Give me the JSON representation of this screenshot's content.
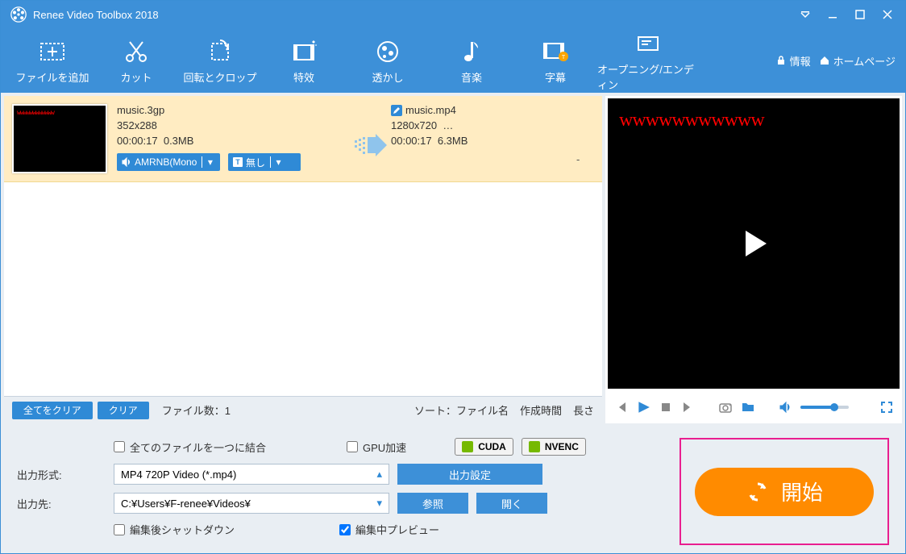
{
  "app": {
    "title": "Renee Video Toolbox 2018"
  },
  "toolbar": {
    "add_file": "ファイルを追加",
    "cut": "カット",
    "rotate_crop": "回転とクロップ",
    "effects": "特效",
    "watermark": "透かし",
    "music": "音楽",
    "subtitle": "字幕",
    "opening": "オープニング/エンディン",
    "info": "情報",
    "homepage": "ホームページ"
  },
  "file": {
    "src_name": "music.3gp",
    "src_res": "352x288",
    "src_dur": "00:00:17",
    "src_size": "0.3MB",
    "dst_name": "music.mp4",
    "dst_res": "1280x720",
    "dst_dots": "…",
    "dst_dur": "00:00:17",
    "dst_size": "6.3MB",
    "audio_dd": "AMRNB(Mono",
    "sub_dd": "無し",
    "sub_val": "-",
    "thumb_wm": "wwwwwwwwwwww"
  },
  "list_footer": {
    "clear_all": "全てをクリア",
    "clear": "クリア",
    "count_label": "ファイル数：1",
    "sort_label": "ソート：",
    "sort_name": "ファイル名",
    "sort_created": "作成時間",
    "sort_length": "長さ"
  },
  "preview": {
    "wm": "wwwwwwwwwww"
  },
  "bottom": {
    "merge_label": "全てのファイルを一つに結合",
    "gpu_label": "GPU加速",
    "cuda": "CUDA",
    "nvenc": "NVENC",
    "out_format_lbl": "出力形式:",
    "out_format_val": "MP4 720P Video (*.mp4)",
    "out_settings": "出力設定",
    "out_dir_lbl": "出力先:",
    "out_dir_val": "C:¥Users¥F-renee¥Videos¥",
    "browse": "参照",
    "open": "開く",
    "shutdown_label": "編集後シャットダウン",
    "preview_label": "編集中プレビュー",
    "start": "開始"
  }
}
